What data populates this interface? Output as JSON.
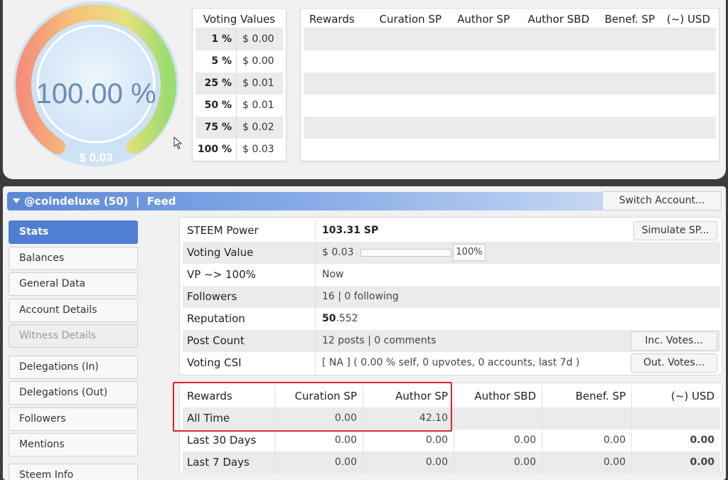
{
  "gauge": {
    "percent": "100.00 %",
    "value": "$ 0.03"
  },
  "voting_values": {
    "title": "Voting Values",
    "rows": [
      {
        "pct": "1 %",
        "usd": "$ 0.00"
      },
      {
        "pct": "5 %",
        "usd": "$ 0.00"
      },
      {
        "pct": "25 %",
        "usd": "$ 0.01"
      },
      {
        "pct": "50 %",
        "usd": "$ 0.01"
      },
      {
        "pct": "75 %",
        "usd": "$ 0.02"
      },
      {
        "pct": "100 %",
        "usd": "$ 0.03"
      }
    ]
  },
  "rewards_top": {
    "headers": [
      "Rewards",
      "Curation SP",
      "Author SP",
      "Author SBD",
      "Benef. SP",
      "(~) USD"
    ]
  },
  "account_bar": {
    "title": "@coindeluxe (50)  |  Feed",
    "switch_label": "Switch Account..."
  },
  "nav": {
    "items": [
      {
        "label": "Stats"
      },
      {
        "label": "Balances"
      },
      {
        "label": "General Data"
      },
      {
        "label": "Account Details"
      },
      {
        "label": "Witness Details"
      },
      {
        "label": "Delegations (In)"
      },
      {
        "label": "Delegations (Out)"
      },
      {
        "label": "Followers"
      },
      {
        "label": "Mentions"
      },
      {
        "label": "Steem Info"
      }
    ]
  },
  "stats": {
    "steem_power": {
      "label": "STEEM Power",
      "value": "103.31 SP",
      "button": "Simulate SP..."
    },
    "voting_value": {
      "label": "Voting Value",
      "value": "$ 0.03",
      "percent": "100%"
    },
    "vp": {
      "label": "VP ~> 100%",
      "value": "Now"
    },
    "followers": {
      "label": "Followers",
      "value": "16 | 0 following"
    },
    "reputation": {
      "label": "Reputation",
      "value_main": "50",
      "value_frac": ".552"
    },
    "post_count": {
      "label": "Post Count",
      "value": "12 posts | 0 comments",
      "button": "Inc. Votes..."
    },
    "voting_csi": {
      "label": "Voting CSI",
      "value": "[ NA ] ( 0.00 % self, 0 upvotes, 0 accounts, last 7d )",
      "button": "Out. Votes..."
    }
  },
  "rewards_table": {
    "headers": [
      "Rewards",
      "Curation SP",
      "Author SP",
      "Author SBD",
      "Benef. SP",
      "(~) USD"
    ],
    "rows": [
      {
        "label": "All Time",
        "curation": "0.00",
        "author_sp": "42.10",
        "author_sbd": "",
        "benef": "",
        "usd": ""
      },
      {
        "label": "Last 30 Days",
        "curation": "0.00",
        "author_sp": "0.00",
        "author_sbd": "0.00",
        "benef": "0.00",
        "usd": "0.00"
      },
      {
        "label": "Last 7 Days",
        "curation": "0.00",
        "author_sp": "0.00",
        "author_sbd": "0.00",
        "benef": "0.00",
        "usd": "0.00"
      }
    ]
  },
  "colors": {
    "accent": "#4f7fd2",
    "highlight": "#d9262b"
  }
}
